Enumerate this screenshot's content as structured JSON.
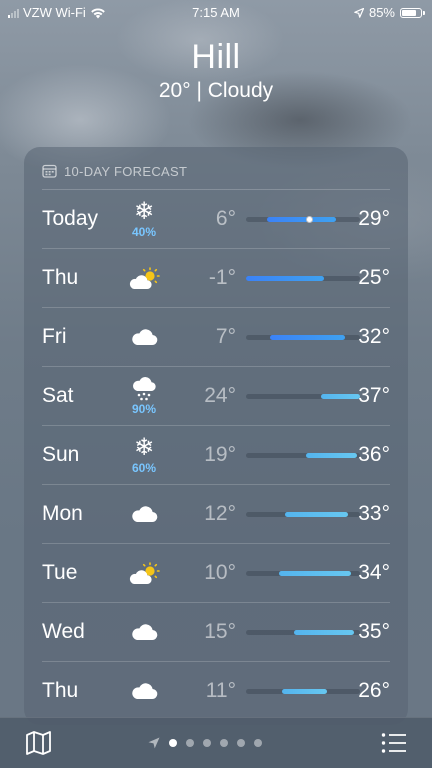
{
  "status_bar": {
    "carrier": "VZW Wi-Fi",
    "time": "7:15 AM",
    "battery": "85%",
    "battery_level": 0.85,
    "icons": [
      "signal-icon",
      "wifi-icon",
      "location-arrow-icon",
      "battery-icon"
    ]
  },
  "header": {
    "city": "Hill",
    "temp_condition": "20°  |  Cloudy"
  },
  "forecast": {
    "title": "10-DAY FORECAST",
    "title_icon": "calendar-icon",
    "range_min": -1,
    "range_max": 37,
    "current_temp": 20,
    "days": [
      {
        "day": "Today",
        "icon": "snowflake-icon",
        "precip": "40%",
        "low": "6°",
        "high": "29°",
        "low_val": 6,
        "high_val": 29
      },
      {
        "day": "Thu",
        "icon": "partly-sunny-icon",
        "precip": "",
        "low": "-1°",
        "high": "25°",
        "low_val": -1,
        "high_val": 25
      },
      {
        "day": "Fri",
        "icon": "cloud-icon",
        "precip": "",
        "low": "7°",
        "high": "32°",
        "low_val": 7,
        "high_val": 32
      },
      {
        "day": "Sat",
        "icon": "cloud-snow-icon",
        "precip": "90%",
        "low": "24°",
        "high": "37°",
        "low_val": 24,
        "high_val": 37
      },
      {
        "day": "Sun",
        "icon": "snowflake-icon",
        "precip": "60%",
        "low": "19°",
        "high": "36°",
        "low_val": 19,
        "high_val": 36
      },
      {
        "day": "Mon",
        "icon": "cloud-icon",
        "precip": "",
        "low": "12°",
        "high": "33°",
        "low_val": 12,
        "high_val": 33
      },
      {
        "day": "Tue",
        "icon": "partly-sunny-icon",
        "precip": "",
        "low": "10°",
        "high": "34°",
        "low_val": 10,
        "high_val": 34
      },
      {
        "day": "Wed",
        "icon": "cloud-icon",
        "precip": "",
        "low": "15°",
        "high": "35°",
        "low_val": 15,
        "high_val": 35
      },
      {
        "day": "Thu",
        "icon": "cloud-icon",
        "precip": "",
        "low": "11°",
        "high": "26°",
        "low_val": 11,
        "high_val": 26
      }
    ]
  },
  "toolbar": {
    "map_icon": "map-icon",
    "list_icon": "list-icon",
    "pages": 6,
    "current_page": 1
  },
  "colors": {
    "bar_warm": "#5ab9ee",
    "bar_cold": "#3b82f6",
    "precip": "#79c6ff",
    "sun": "#f5c518"
  }
}
